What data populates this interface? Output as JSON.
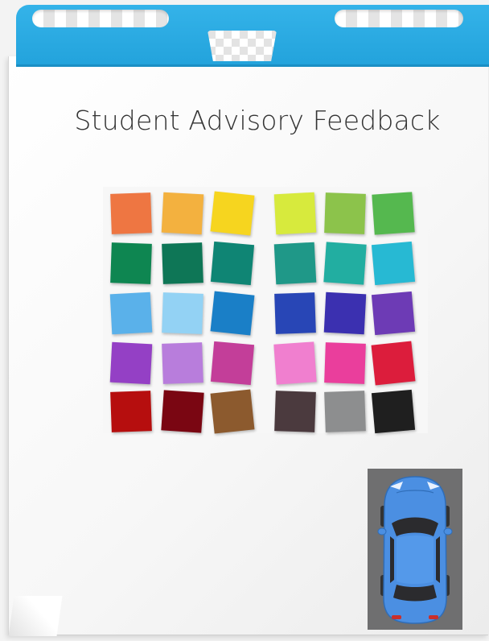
{
  "title": "Student Advisory Feedback",
  "swatch_colors": [
    [
      "#ee7642",
      "#f3b13f",
      "#f6d51f",
      "#d7ea3d",
      "#8cc34b",
      "#55b84f"
    ],
    [
      "#0e8651",
      "#0e7656",
      "#0f8574",
      "#1f9888",
      "#22aea1",
      "#27b9d3"
    ],
    [
      "#5ab1ea",
      "#93d2f4",
      "#1a7fc7",
      "#2846b6",
      "#3b30b0",
      "#6d3bb5"
    ],
    [
      "#9440c5",
      "#b87ddc",
      "#c33e99",
      "#f07fcf",
      "#ea3e9c",
      "#dc1d3c"
    ],
    [
      "#b60e0e",
      "#7a0612",
      "#8c5a2e",
      "#4b3a3e",
      "#8d8e8f",
      "#1f1f1f"
    ]
  ],
  "colors": {
    "header": "#27a6df",
    "car_body": "#4b8fe2",
    "car_backdrop": "#6f6f70"
  }
}
